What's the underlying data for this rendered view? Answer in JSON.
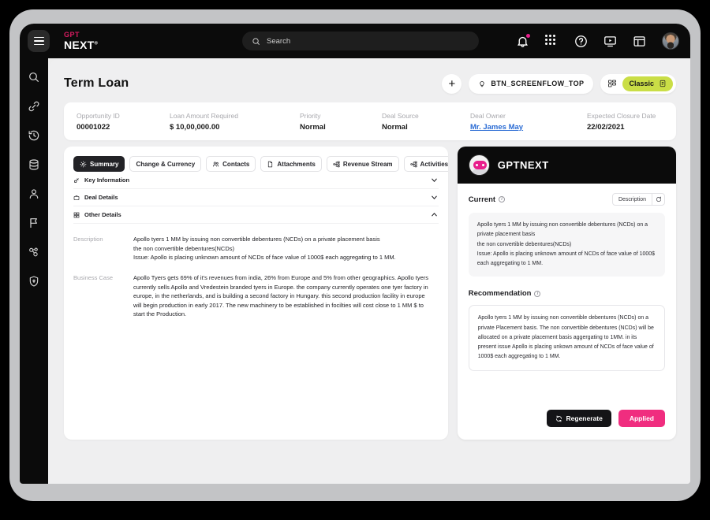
{
  "topbar": {
    "menu_icon": "hamburger-icon",
    "brand_top": "GPT",
    "brand_bottom": "NEXT",
    "brand_mark": "®",
    "search_placeholder": "Search",
    "search_value": "",
    "icons": [
      "bell-icon",
      "apps-grid-icon",
      "help-circle-icon",
      "screen-play-icon",
      "layout-panel-icon",
      "user-avatar"
    ]
  },
  "sidebar": {
    "items": [
      {
        "name": "search-icon",
        "label": "Search"
      },
      {
        "name": "link-icon",
        "label": "Links"
      },
      {
        "name": "history-icon",
        "label": "History"
      },
      {
        "name": "database-icon",
        "label": "Database"
      },
      {
        "name": "user-icon",
        "label": "Contacts"
      },
      {
        "name": "announcement-icon",
        "label": "Announcements"
      },
      {
        "name": "network-icon",
        "label": "Network"
      },
      {
        "name": "shield-icon",
        "label": "Security"
      }
    ]
  },
  "page": {
    "title": "Term Loan",
    "add_button": "+",
    "screenflow_button": "BTN_SCREENFLOW_TOP",
    "view_chip": "Classic"
  },
  "summary_fields": [
    {
      "label": "Opportunity ID",
      "value": "00001022",
      "link": false
    },
    {
      "label": "Loan Amount Required",
      "value": "$ 10,00,000.00",
      "link": false
    },
    {
      "label": "Priority",
      "value": "Normal",
      "link": false
    },
    {
      "label": "Deal Source",
      "value": "Normal",
      "link": false
    },
    {
      "label": "Deal Owner",
      "value": "Mr. James May",
      "link": true
    },
    {
      "label": "Expected Closure Date",
      "value": "22/02/2021",
      "link": false
    }
  ],
  "tabs": [
    {
      "label": "Summary",
      "icon": "gear-icon",
      "active": true
    },
    {
      "label": "Change & Currency",
      "icon": "none",
      "active": false
    },
    {
      "label": "Contacts",
      "icon": "contacts-icon",
      "active": false
    },
    {
      "label": "Attachments",
      "icon": "file-icon",
      "active": false
    },
    {
      "label": "Revenue Stream",
      "icon": "hierarchy-icon",
      "active": false
    },
    {
      "label": "Activities",
      "icon": "hierarchy-icon",
      "active": false
    }
  ],
  "accordions": [
    {
      "label": "Key Information",
      "icon": "key-icon",
      "expanded": false
    },
    {
      "label": "Deal Details",
      "icon": "briefcase-icon",
      "expanded": false
    },
    {
      "label": "Other Details",
      "icon": "grid-squares-icon",
      "expanded": true
    }
  ],
  "details": [
    {
      "label": "Description",
      "value": "Apollo tyers 1 MM by issuing non convertible debentures (NCDs) on a private placement basis\nthe non convertible debentures(NCDs)\nIssue: Apollo is placing unknown amount of NCDs of face value of 1000$ each aggregating to 1 MM."
    },
    {
      "label": "Business Case",
      "value": "Apollo Tyers gets 69% of it's revenues from india, 26% from Europe and 5% from other geographics. Apollo tyers currently sells Apollo and Vredestein branded tyers in Europe. the company currently operates one tyer factory in europe, in the netherlands, and is building a second factory in Hungary. this second production facility in europe will begin production in early 2017. The new machinery to be established in focilties will cost close to 1 MM $ to start the Production."
    }
  ],
  "ai_panel": {
    "title": "GPTNEXT",
    "avatar": "robot-avatar",
    "current_label": "Current",
    "description_toggle": "Description",
    "current_text": "Apollo tyers 1 MM by issuing non convertible debentures (NCDs) on a private placement basis\nthe non convertible debentures(NCDs)\nIssue: Apollo is placing unknown amount of NCDs of face value of 1000$ each aggregating to 1 MM.",
    "recommendation_label": "Recommendation",
    "recommendation_text": "Apollo tyers 1 MM by issuing non convertible debentures (NCDs) on a  private Placement basis.  The non convertible debentures (NCDs) will be allocated on a private placement basis aggergating to 1MM. in its present issue Apollo is placing unkown amount of NCDs of face value of 1000$ each aggregating to 1 MM.",
    "regenerate_button": "Regenerate",
    "applied_button": "Applied"
  },
  "colors": {
    "brand_pink": "#d81b60",
    "accent_pink": "#f02d7f",
    "chip_green": "#cade46",
    "link_blue": "#2b6cd4",
    "dark": "#0b0b0b"
  }
}
